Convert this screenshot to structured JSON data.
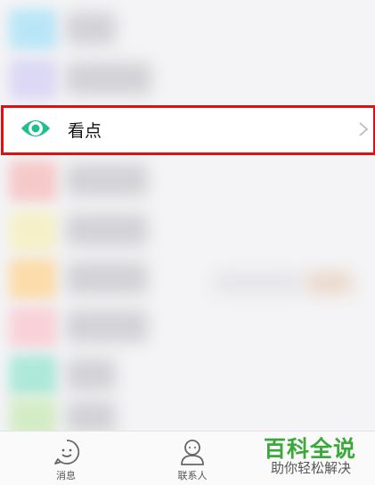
{
  "feature_row": {
    "label": "看点",
    "icon": "eye-icon",
    "accent": "#1fbf8f",
    "highlight_color": "#e01010"
  },
  "tabbar": {
    "tabs": [
      {
        "label": "消息",
        "icon": "smiley-chat-icon"
      },
      {
        "label": "联系人",
        "icon": "person-icon"
      }
    ]
  },
  "watermark": {
    "title": "百科全说",
    "subtitle": "助你轻松解决",
    "color": "#3aa83a"
  }
}
